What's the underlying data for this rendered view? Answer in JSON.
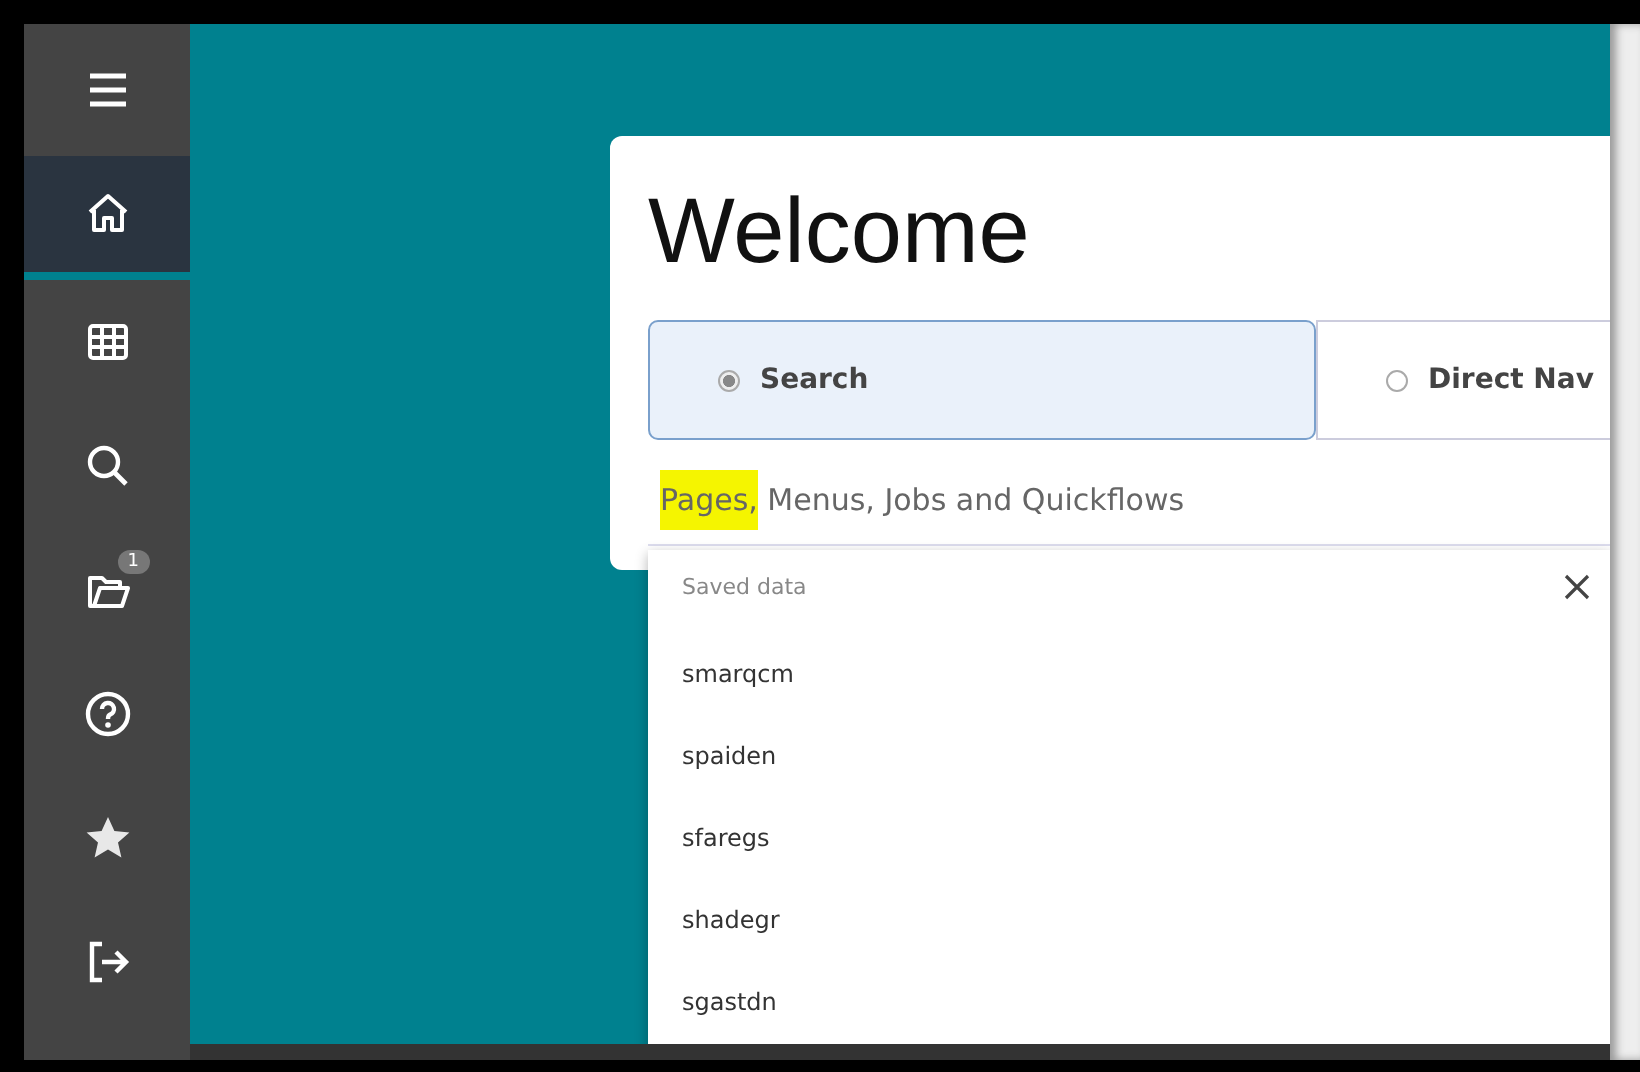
{
  "sidebar": {
    "items": [
      {
        "kind": "menu",
        "selected": false
      },
      {
        "kind": "home",
        "selected": true
      },
      {
        "kind": "grid",
        "selected": false
      },
      {
        "kind": "search",
        "selected": false
      },
      {
        "kind": "folder",
        "selected": false,
        "badge": "1"
      },
      {
        "kind": "help",
        "selected": false
      },
      {
        "kind": "star",
        "selected": false
      },
      {
        "kind": "logout",
        "selected": false
      }
    ]
  },
  "welcome": {
    "title": "Welcome",
    "modes": [
      {
        "label": "Search",
        "selected": true
      },
      {
        "label": "Direct Nav",
        "selected": false
      }
    ],
    "search_field": {
      "placeholder": "Pages, Menus, Jobs and Quickflows",
      "first_word_highlighted": true
    },
    "saved_data": {
      "title": "Saved data",
      "items": [
        "smarqcm",
        "spaiden",
        "sfaregs",
        "shadegr",
        "sgastdn"
      ]
    }
  }
}
